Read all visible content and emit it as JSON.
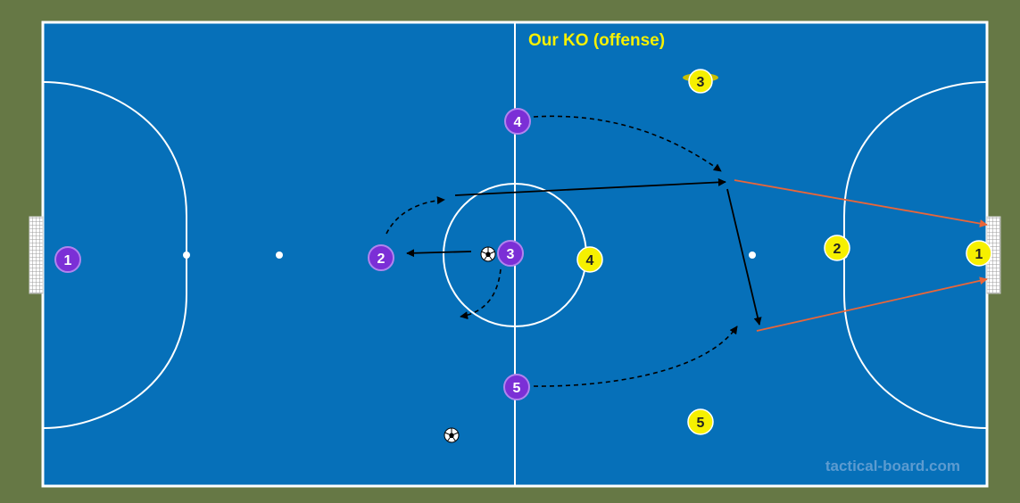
{
  "title": "Our KO (offense)",
  "watermark": "tactical-board.com",
  "colors": {
    "background": "#667845",
    "pitch": "#0670b9",
    "lines": "#ffffff",
    "team_purple": "#7b2fd6",
    "team_yellow": "#f6f000",
    "pass_line": "#000000",
    "shot_line": "#e8663a"
  },
  "players": {
    "purple_1": "1",
    "purple_2": "2",
    "purple_3": "3",
    "purple_4": "4",
    "purple_5": "5",
    "yellow_1": "1",
    "yellow_2": "2",
    "yellow_3": "3",
    "yellow_4": "4",
    "yellow_5": "5"
  },
  "icons": [
    "soccer-ball-icon",
    "goal-net-icon",
    "cone-marker-icon"
  ]
}
